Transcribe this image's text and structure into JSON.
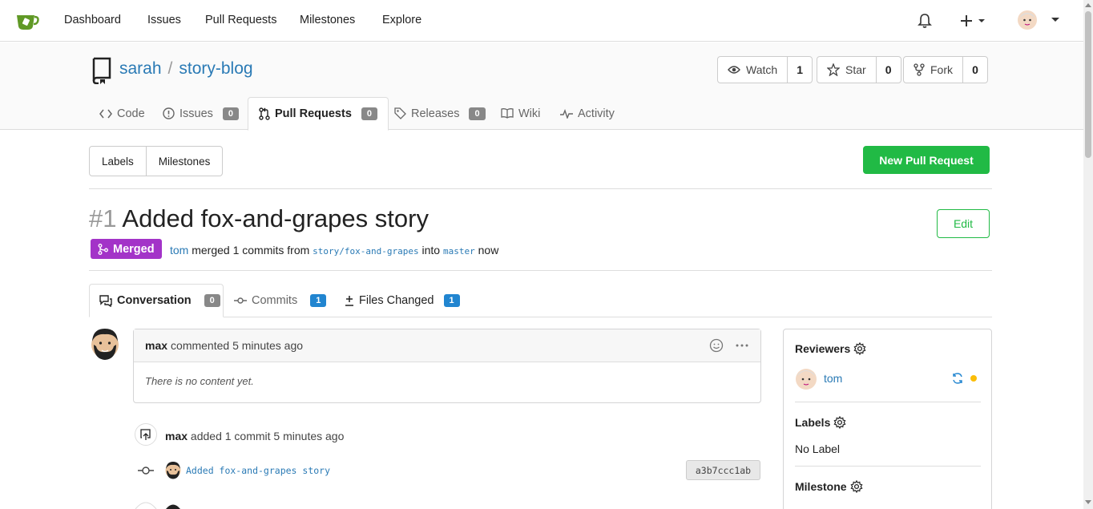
{
  "nav": {
    "items": [
      "Dashboard",
      "Issues",
      "Pull Requests",
      "Milestones",
      "Explore"
    ],
    "icons": [
      "bell-icon",
      "plus-icon",
      "avatar"
    ]
  },
  "repo": {
    "owner": "sarah",
    "separator": "/",
    "name": "story-blog",
    "watch_label": "Watch",
    "watch_count": "1",
    "star_label": "Star",
    "star_count": "0",
    "fork_label": "Fork",
    "fork_count": "0"
  },
  "repo_tabs": {
    "code": "Code",
    "issues": "Issues",
    "issues_count": "0",
    "pulls": "Pull Requests",
    "pulls_count": "0",
    "releases": "Releases",
    "releases_count": "0",
    "wiki": "Wiki",
    "activity": "Activity"
  },
  "filters": {
    "labels": "Labels",
    "milestones": "Milestones",
    "new_pr": "New Pull Request"
  },
  "pr": {
    "number": "#1",
    "title": "Added fox-and-grapes story",
    "edit": "Edit",
    "status": "Merged",
    "author": "tom",
    "merged_text": "merged 1 commits from",
    "head_branch": "story/fox-and-grapes",
    "into": "into",
    "base_branch": "master",
    "time": "now"
  },
  "pr_tabs": {
    "conversation": "Conversation",
    "conversation_count": "0",
    "commits": "Commits",
    "commits_count": "1",
    "files": "Files Changed",
    "files_count": "1"
  },
  "comment": {
    "author": "max",
    "action": "commented",
    "time": "5 minutes ago",
    "body": "There is no content yet."
  },
  "timeline": {
    "author": "max",
    "text": "added 1 commit 5 minutes ago",
    "commit_message": "Added fox-and-grapes story",
    "sha": "a3b7ccc1ab"
  },
  "sidebar": {
    "reviewers_title": "Reviewers",
    "reviewer": "tom",
    "labels_title": "Labels",
    "labels_value": "No Label",
    "milestone_title": "Milestone"
  },
  "colors": {
    "green": "#21ba45",
    "purple": "#a333c8",
    "link": "#2a7ab5",
    "badge_blue": "#2185d0",
    "pending": "#fbbd08"
  }
}
